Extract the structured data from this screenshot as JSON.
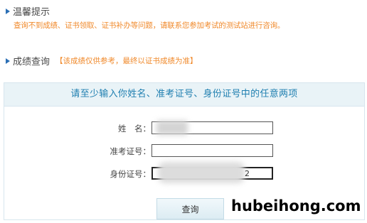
{
  "tip": {
    "heading": "温馨提示",
    "text": "查询不到成绩、证书领取、证书补办等问题，请联系您参加考试的测试站进行咨询。"
  },
  "query": {
    "heading": "成绩查询",
    "note": "【该成绩仅供参考，最终以证书成绩为准】",
    "panel_title": "请至少输入你姓名、准考证号、身份证号中的任意两项",
    "name_label": "姓　名：",
    "name_value": "",
    "exam_label": "准考证号：",
    "exam_value": "",
    "id_label": "身份证号：",
    "id_value_tail": "2",
    "button_label": "查询"
  },
  "watermark": "hubeihong.com",
  "colors": {
    "accent_orange": "#f08a2c",
    "panel_title_blue": "#1f7fb0",
    "panel_bg": "#e9f3f7",
    "marker_blue": "#2b6fb5"
  }
}
